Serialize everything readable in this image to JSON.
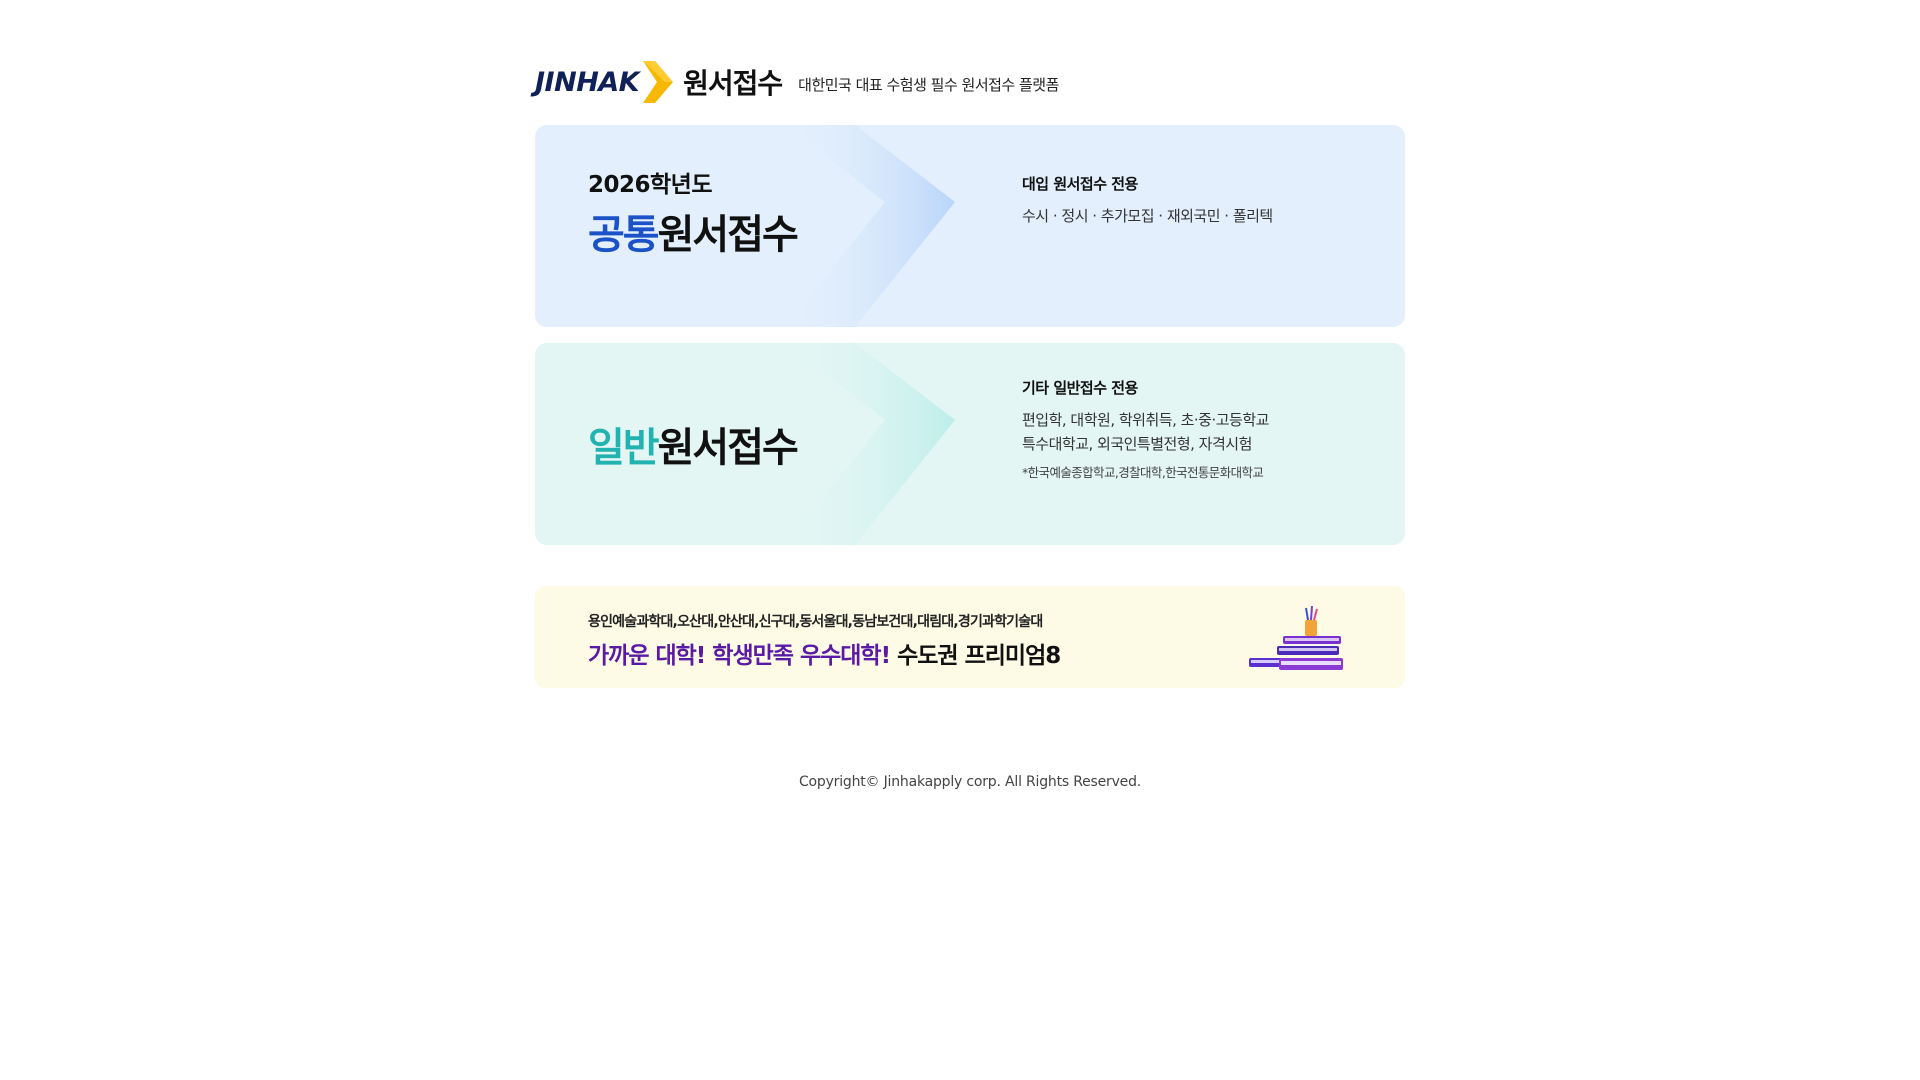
{
  "header": {
    "logo_word": "JINHAK",
    "logo_title": "원서접수",
    "tagline": "대한민국 대표 수험생 필수 원서접수 플랫폼",
    "brand_colors": {
      "navy": "#10215a",
      "arrow": "#f6b800"
    }
  },
  "cards": {
    "common": {
      "year": "2026학년도",
      "accent": "공통",
      "rest": "원서접수",
      "info_head": "대입 원서접수 전용",
      "info_line1": "수시 · 정시 · 추가모집 · 재외국민 · 폴리텍",
      "background": "#e3effc",
      "accent_color": "#1c52c8"
    },
    "general": {
      "accent": "일반",
      "rest": "원서접수",
      "info_head": "기타 일반접수 전용",
      "info_line1": "편입학, 대학원, 학위취득, 초·중·고등학교",
      "info_line2": "특수대학교, 외국인특별전형, 자격시험",
      "info_note": "*한국예술종합학교,경찰대학,한국전통문화대학교",
      "background": "#e3f6f4",
      "accent_color": "#22b3b0"
    }
  },
  "banner": {
    "small": "용인예술과학대,오산대,안산대,신구대,동서울대,동남보건대,대림대,경기과학기술대",
    "big_purple": "가까운 대학! 학생만족 우수대학!",
    "big_dark": "수도권 프리미엄8",
    "background": "#fdfbe6",
    "icon": "books-icon"
  },
  "footer": {
    "copyright": "Copyright© Jinhakapply corp. All Rights Reserved."
  }
}
